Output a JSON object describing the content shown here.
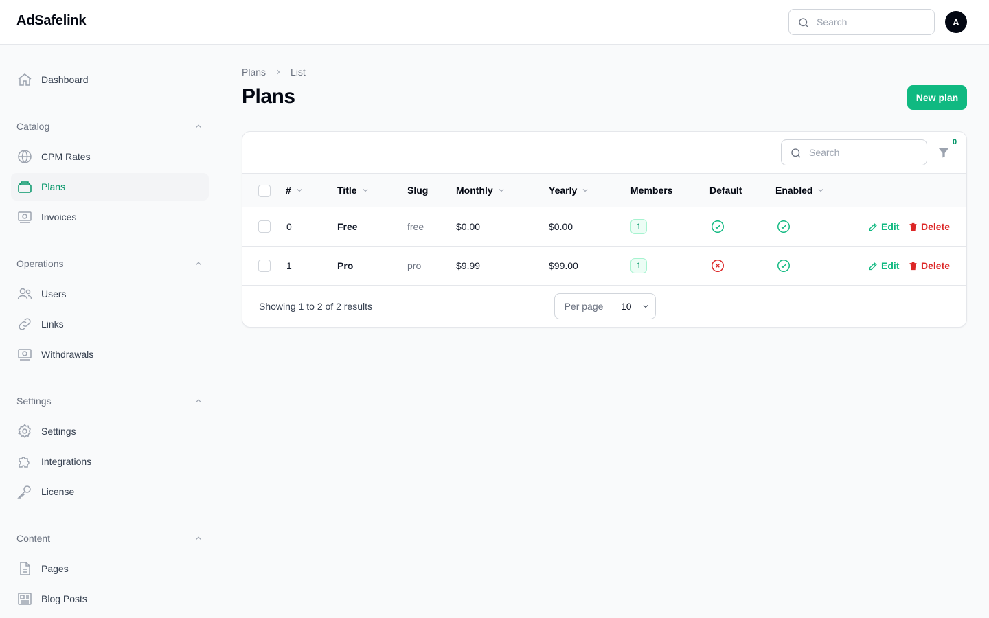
{
  "app": {
    "brand": "AdSafelink",
    "search_placeholder": "Search",
    "avatar_initial": "A"
  },
  "sidebar": {
    "dashboard": "Dashboard",
    "groups": [
      {
        "label": "Catalog",
        "items": [
          "CPM Rates",
          "Plans",
          "Invoices"
        ]
      },
      {
        "label": "Operations",
        "items": [
          "Users",
          "Links",
          "Withdrawals"
        ]
      },
      {
        "label": "Settings",
        "items": [
          "Settings",
          "Integrations",
          "License"
        ]
      },
      {
        "label": "Content",
        "items": [
          "Pages",
          "Blog Posts"
        ]
      }
    ],
    "active_item": "Plans",
    "accent_color": "#059669"
  },
  "breadcrumb": {
    "parent": "Plans",
    "current": "List"
  },
  "page": {
    "title": "Plans",
    "new_button": "New plan",
    "button_color": "#10b981"
  },
  "table": {
    "search_placeholder": "Search",
    "filter_count": "0",
    "columns": [
      "#",
      "Title",
      "Slug",
      "Monthly",
      "Yearly",
      "Members",
      "Default",
      "Enabled"
    ],
    "rows": [
      {
        "id": "0",
        "title": "Free",
        "slug": "free",
        "monthly": "$0.00",
        "yearly": "$0.00",
        "members": "1",
        "default": true,
        "enabled": true
      },
      {
        "id": "1",
        "title": "Pro",
        "slug": "pro",
        "monthly": "$9.99",
        "yearly": "$99.00",
        "members": "1",
        "default": false,
        "enabled": true
      }
    ],
    "edit_label": "Edit",
    "delete_label": "Delete",
    "footer": "Showing 1 to 2 of 2 results",
    "per_page_label": "Per page",
    "per_page_value": "10"
  }
}
